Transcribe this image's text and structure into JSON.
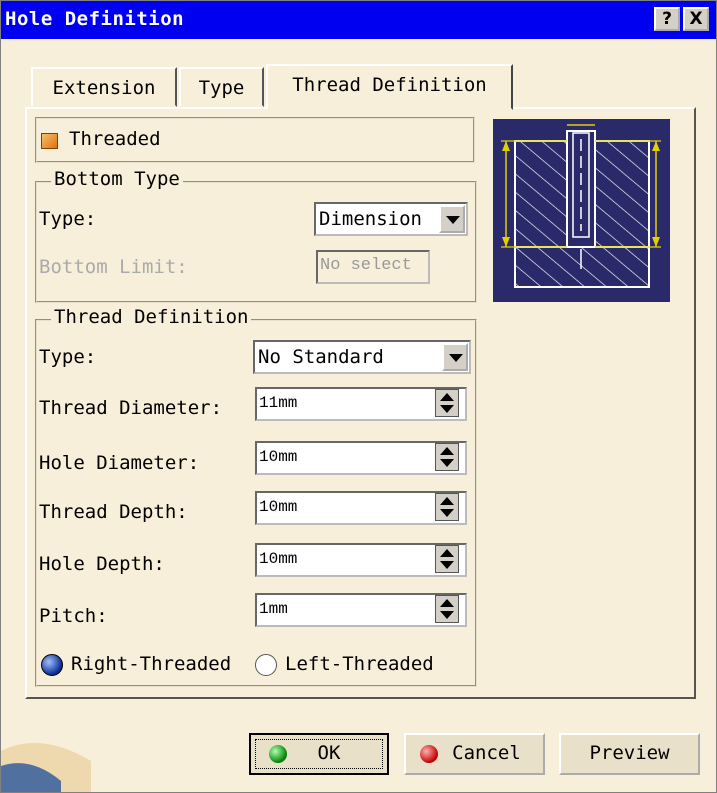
{
  "window": {
    "title": "Hole Definition",
    "help_btn": "?",
    "close_btn": "X"
  },
  "tabs": [
    {
      "label": "Extension"
    },
    {
      "label": "Type"
    },
    {
      "label": "Thread Definition"
    }
  ],
  "threaded_checkbox": {
    "label": "Threaded",
    "checked": true
  },
  "bottom_type": {
    "group_title": "Bottom Type",
    "type_label": "Type:",
    "type_value": "Dimension",
    "bottom_limit_label": "Bottom Limit:",
    "bottom_limit_value": "No select"
  },
  "thread_definition": {
    "group_title": "Thread Definition",
    "type_label": "Type:",
    "type_value": "No Standard",
    "fields": [
      {
        "label": "Thread Diameter:",
        "value": "11mm"
      },
      {
        "label": "Hole Diameter:",
        "value": "10mm"
      },
      {
        "label": "Thread Depth:",
        "value": "10mm"
      },
      {
        "label": "Hole Depth:",
        "value": "10mm"
      },
      {
        "label": "Pitch:",
        "value": "1mm"
      }
    ],
    "right_threaded_label": "Right-Threaded",
    "left_threaded_label": "Left-Threaded",
    "selected": "Right-Threaded"
  },
  "buttons": {
    "ok": "OK",
    "cancel": "Cancel",
    "preview": "Preview"
  },
  "colors": {
    "titlebar": "#0000f0",
    "dialog_bg": "#f7efd9",
    "preview_bg": "#2a2a6a",
    "dimension_lines": "#e0d000"
  }
}
